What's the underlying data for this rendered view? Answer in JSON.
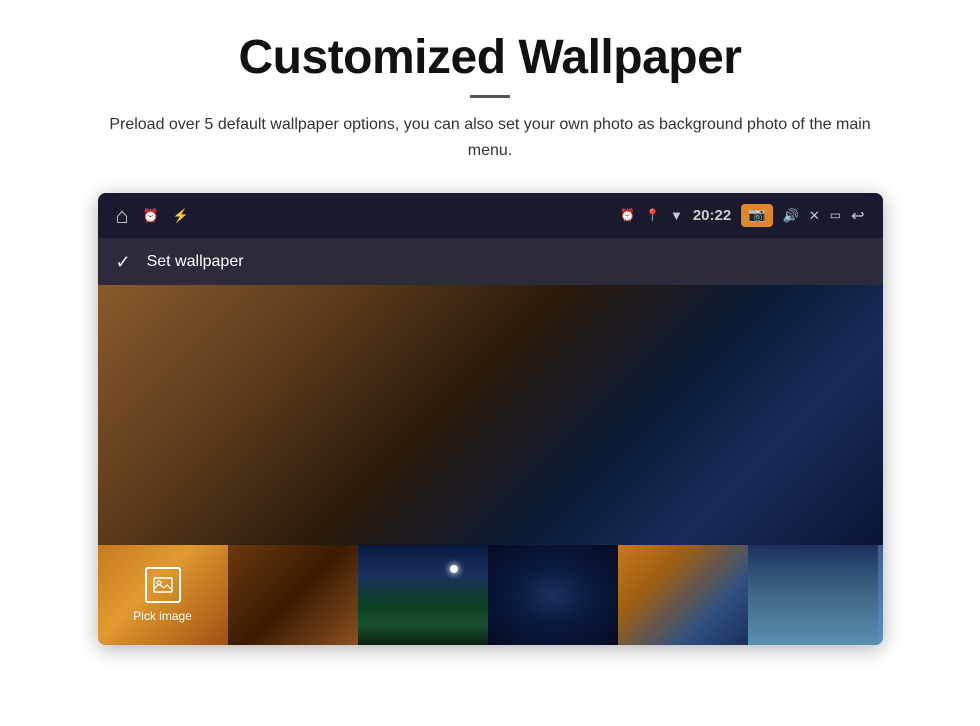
{
  "page": {
    "title": "Customized Wallpaper",
    "subtitle": "Preload over 5 default wallpaper options, you can also set your own photo as background photo of the main menu."
  },
  "device": {
    "statusBar": {
      "time": "20:22",
      "leftIcons": [
        "home",
        "alarm",
        "usb"
      ],
      "rightIcons": [
        "alarm-clock",
        "location",
        "wifi",
        "camera",
        "volume",
        "close",
        "window",
        "back"
      ]
    },
    "actionBar": {
      "checkmark": "✓",
      "label": "Set wallpaper"
    },
    "thumbnails": {
      "pickLabel": "Pick image",
      "items": [
        "pick",
        "dark-orange",
        "space-aurora",
        "galaxy",
        "sunset-ocean",
        "blue-abstract",
        "partial-blue"
      ]
    }
  }
}
